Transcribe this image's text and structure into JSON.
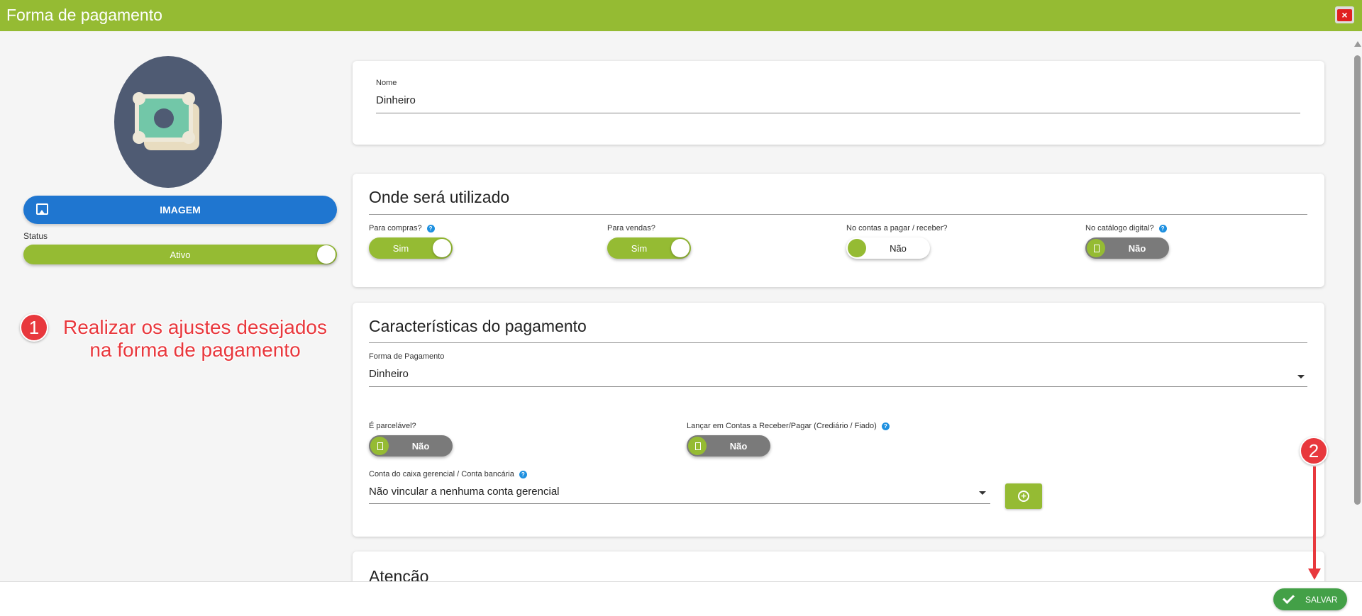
{
  "window": {
    "title": "Forma de pagamento",
    "close_icon": "×"
  },
  "left": {
    "image_button_label": "IMAGEM",
    "status_label": "Status",
    "status_value": "Ativo",
    "status_on": true
  },
  "annotations": {
    "step1_number": "1",
    "step1_line1": "Realizar os ajustes desejados",
    "step1_line2": "na forma de pagamento",
    "step2_number": "2"
  },
  "name_card": {
    "label": "Nome",
    "value": "Dinheiro"
  },
  "usage": {
    "title": "Onde será utilizado",
    "items": [
      {
        "label": "Para compras?",
        "has_help": true,
        "value": "Sim",
        "state": "on"
      },
      {
        "label": "Para vendas?",
        "has_help": false,
        "value": "Sim",
        "state": "on"
      },
      {
        "label": "No contas a pagar / receber?",
        "has_help": false,
        "value": "Não",
        "state": "off"
      },
      {
        "label": "No catálogo digital?",
        "has_help": true,
        "value": "Não",
        "state": "off"
      }
    ]
  },
  "payment": {
    "title": "Características do pagamento",
    "method_label": "Forma de Pagamento",
    "method_value": "Dinheiro",
    "installment_label": "É parcelável?",
    "installment_value": "Não",
    "post_label": "Lançar em Contas a Receber/Pagar (Crediário / Fiado)",
    "post_value": "Não",
    "account_label": "Conta do caixa gerencial / Conta bancária",
    "account_value": "Não vincular a nenhuma conta gerencial",
    "add_icon": "+"
  },
  "attention": {
    "title": "Atenção"
  },
  "footer": {
    "save_label": "SALVAR"
  },
  "colors": {
    "brand_green": "#95bb33",
    "blue": "#1f76d0",
    "save_green": "#43a047",
    "annotation_red": "#e8383d"
  }
}
